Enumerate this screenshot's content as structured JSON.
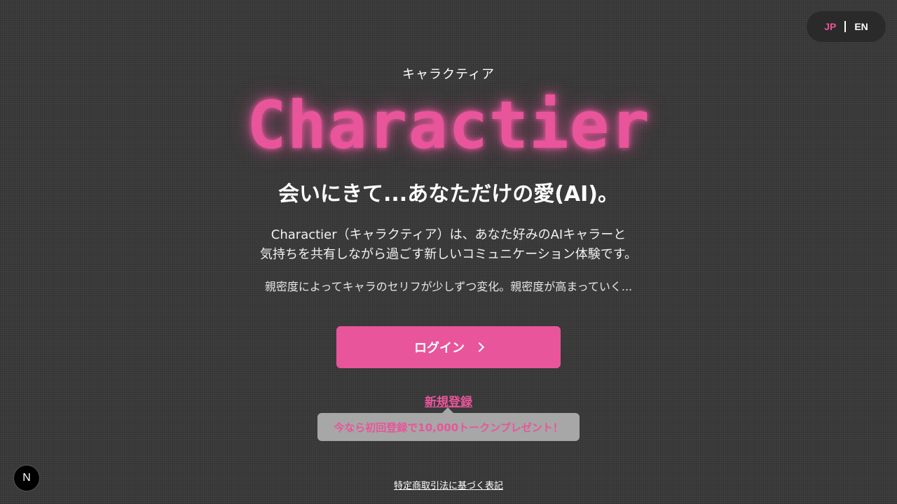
{
  "language_toggle": {
    "jp_label": "JP",
    "en_label": "EN",
    "active": "JP"
  },
  "hero": {
    "kana_name": "キャラクティア",
    "logo_text": "Charactier",
    "tagline": "会いにきて...あなただけの愛(AI)。",
    "description_line1": "Charactier（キャラクティア）は、あなた好みのAIキャラーと",
    "description_line2": "気持ちを共有しながら過ごす新しいコミュニケーション体験です。",
    "sub_description": "親密度によってキャラのセリフが少しずつ変化。親密度が高まっていく..."
  },
  "actions": {
    "login_label": "ログイン",
    "register_label": "新規登録",
    "promo_text": "今なら初回登録で10,000トークンプレゼント！"
  },
  "footer": {
    "legal_link": "特定商取引法に基づく表記"
  },
  "dev_badge": {
    "letter": "N"
  },
  "colors": {
    "accent": "#e8559a",
    "background": "#3e3e3e",
    "toggle_bg": "#2a2a2a",
    "promo_bg": "#a7a7a7"
  }
}
